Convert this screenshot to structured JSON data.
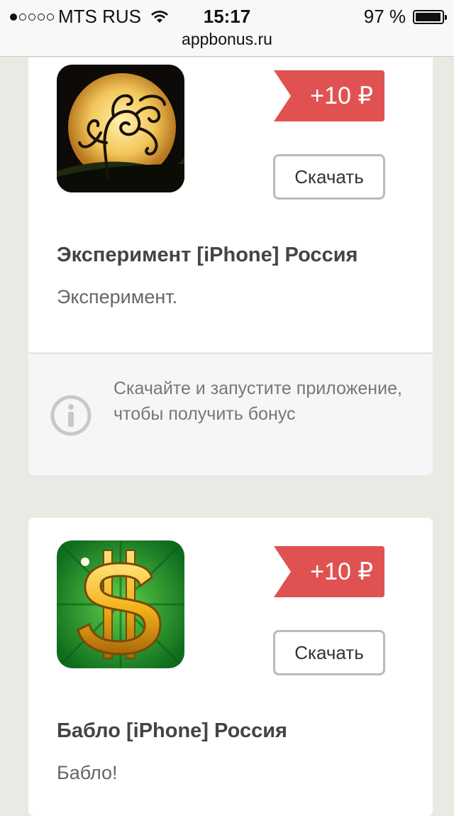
{
  "status_bar": {
    "carrier": "MTS RUS",
    "time": "15:17",
    "battery_percent": "97 %",
    "battery_level": 0.97,
    "signal_bars": 1,
    "url": "appbonus.ru"
  },
  "apps": [
    {
      "icon": "tree-moon-icon",
      "reward": "+10 ₽",
      "download_label": "Скачать",
      "title": "Эксперимент [iPhone] Россия",
      "description": "Эксперимент."
    },
    {
      "icon": "gold-dollar-icon",
      "reward": "+10 ₽",
      "download_label": "Скачать",
      "title": "Бабло [iPhone] Россия",
      "description": "Бабло!"
    }
  ],
  "info": {
    "icon": "info-icon",
    "text": "Скачайте и запустите приложение, чтобы получить бонус"
  },
  "colors": {
    "background": "#ebe9e4",
    "reward_tag": "#e05252",
    "card": "#ffffff",
    "info_box": "#f6f6f6"
  }
}
